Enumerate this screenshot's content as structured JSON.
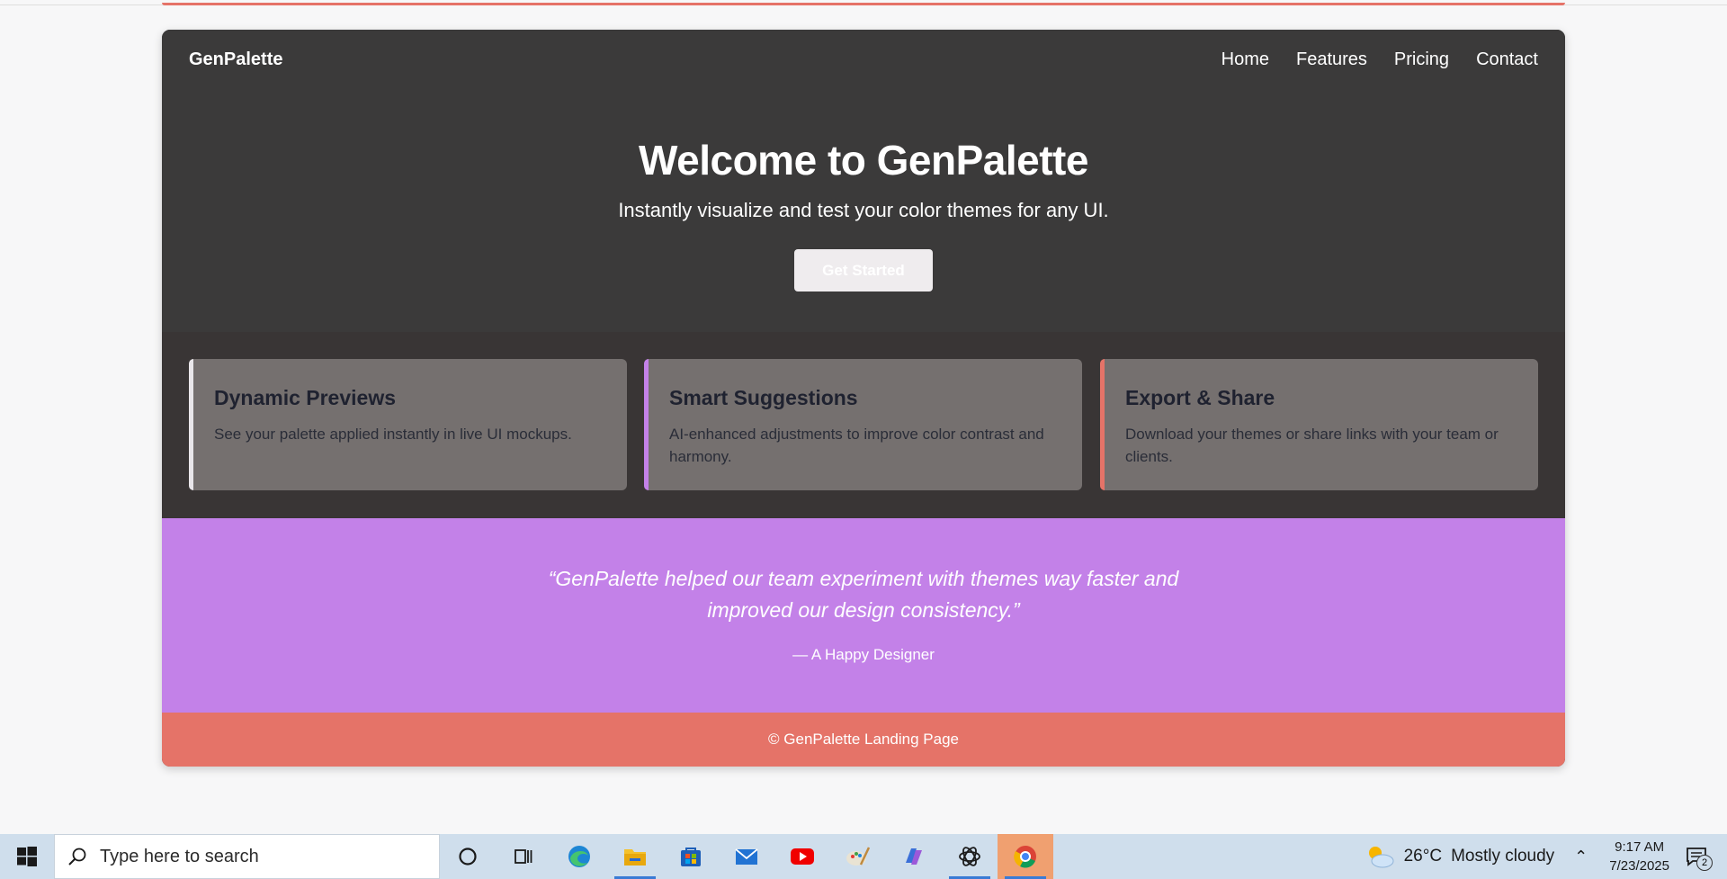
{
  "site": {
    "brand": "GenPalette",
    "nav": [
      "Home",
      "Features",
      "Pricing",
      "Contact"
    ],
    "hero": {
      "title": "Welcome to GenPalette",
      "subtitle": "Instantly visualize and test your color themes for any UI.",
      "cta": "Get Started"
    },
    "features": [
      {
        "title": "Dynamic Previews",
        "text": "See your palette applied instantly in live UI mockups.",
        "accent": "#e9e6ea"
      },
      {
        "title": "Smart Suggestions",
        "text": "AI-enhanced adjustments to improve color contrast and harmony.",
        "accent": "#c381e8"
      },
      {
        "title": "Export & Share",
        "text": "Download your themes or share links with your team or clients.",
        "accent": "#e57368"
      }
    ],
    "testimonial": {
      "quote": "“GenPalette helped our team experiment with themes way faster and improved our design consistency.”",
      "author": "— A Happy Designer"
    },
    "footer": "© GenPalette Landing Page"
  },
  "colors": {
    "hero_bg": "#3b3a3a",
    "features_bg": "#393535",
    "card_bg": "#75706f",
    "testimonial_bg": "#c381e8",
    "footer_bg": "#e57368"
  },
  "taskbar": {
    "search_placeholder": "Type here to search",
    "apps": [
      "cortana-icon",
      "task-view-icon",
      "edge-icon",
      "file-explorer-icon",
      "store-icon",
      "mail-icon",
      "youtube-icon",
      "paint-icon",
      "copilot-icon",
      "chatgpt-icon",
      "chrome-icon"
    ],
    "weather": {
      "temp": "26°C",
      "desc": "Mostly cloudy"
    },
    "time": "9:17 AM",
    "date": "7/23/2025",
    "notifications": "2"
  }
}
